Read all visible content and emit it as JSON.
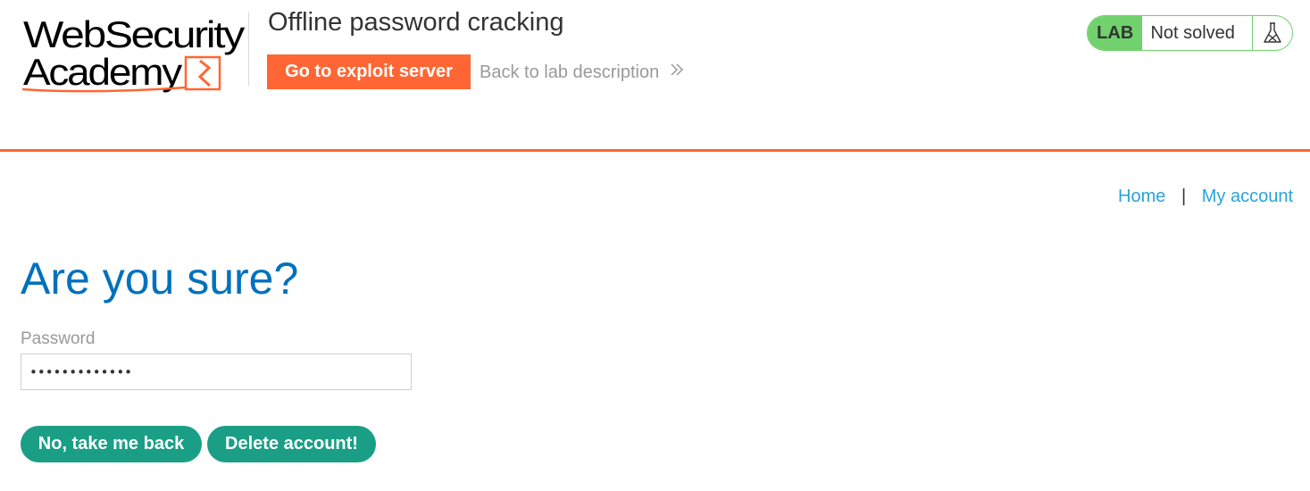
{
  "header": {
    "logo": {
      "line1": "WebSecurity",
      "line2": "Academy",
      "accent_color": "#ff6633"
    },
    "lab_title": "Offline password cracking",
    "exploit_button_label": "Go to exploit server",
    "back_link_label": "Back to lab description",
    "back_link_icon": "double-chevron-right-icon",
    "status": {
      "badge": "LAB",
      "text": "Not solved",
      "icon": "flask-icon",
      "color": "#70d16d"
    }
  },
  "nav": {
    "home_label": "Home",
    "separator": "|",
    "account_label": "My account",
    "link_color": "#29a3d9"
  },
  "main": {
    "heading": "Are you sure?",
    "password_label": "Password",
    "password_value": "•••••••••••••",
    "back_button_label": "No, take me back",
    "delete_button_label": "Delete account!",
    "button_color": "#1a9f86",
    "heading_color": "#0071bc"
  }
}
